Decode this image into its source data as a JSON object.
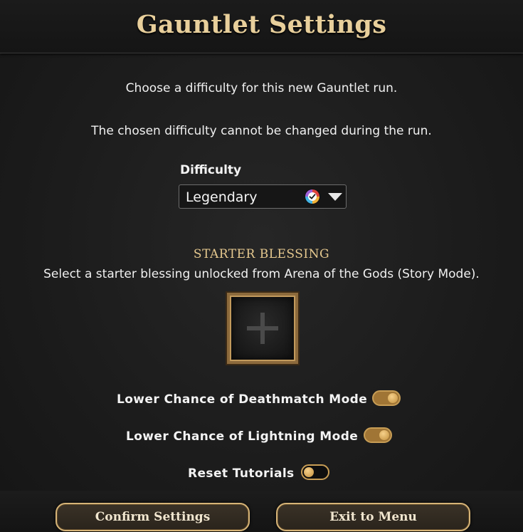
{
  "header": {
    "title": "Gauntlet Settings"
  },
  "intro": {
    "line1": "Choose a difficulty for this new Gauntlet run.",
    "line2": "The chosen difficulty cannot be changed during the run."
  },
  "difficulty": {
    "label": "Difficulty",
    "selected": "Legendary"
  },
  "starter_blessing": {
    "title": "STARTER BLESSING",
    "description": "Select a starter blessing unlocked from Arena of the Gods (Story Mode)."
  },
  "options": [
    {
      "label": "Lower Chance of Deathmatch Mode",
      "enabled": true
    },
    {
      "label": "Lower Chance of Lightning Mode",
      "enabled": true
    },
    {
      "label": "Reset Tutorials",
      "enabled": false
    }
  ],
  "footer": {
    "confirm_label": "Confirm Settings",
    "exit_label": "Exit to Menu"
  },
  "colors": {
    "title_gold": "#e8cf9b",
    "toggle_on": "#a07535",
    "button_border": "#d6b478"
  }
}
